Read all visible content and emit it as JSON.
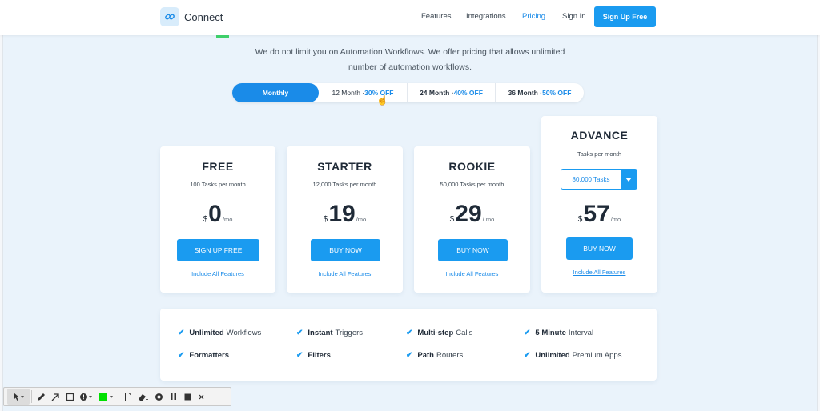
{
  "nav": {
    "brand": "Connect",
    "links": [
      "Features",
      "Integrations",
      "Pricing",
      "Sign In"
    ],
    "active_link": "Pricing",
    "signup_label": "Sign Up Free"
  },
  "intro": {
    "line1": "We do not limit you on Automation Workflows. We offer pricing that allows unlimited",
    "line2": "number of automation workflows."
  },
  "periods": [
    {
      "label": "Monthly",
      "off": ""
    },
    {
      "label": "12 Month · ",
      "off": "30% OFF"
    },
    {
      "label": "24 Month · ",
      "off": "40% OFF"
    },
    {
      "label": "36 Month · ",
      "off": "50% OFF"
    }
  ],
  "plans": [
    {
      "name": "FREE",
      "tasks": "100 Tasks per month",
      "currency": "$",
      "price": "0",
      "per": "/mo",
      "cta": "SIGN UP FREE",
      "link": "Include All Features"
    },
    {
      "name": "STARTER",
      "tasks": "12,000 Tasks per month",
      "currency": "$",
      "price": "19",
      "per": "/mo",
      "cta": "BUY NOW",
      "link": "Include All Features"
    },
    {
      "name": "ROOKIE",
      "tasks": "50,000 Tasks per month",
      "currency": "$",
      "price": "29",
      "per": "/ mo",
      "cta": "BUY NOW",
      "link": "Include All Features"
    },
    {
      "name": "ADVANCE",
      "tasks": "Tasks per month",
      "select_value": "80,000 Tasks",
      "currency": "$",
      "price": "57",
      "per": "/mo",
      "cta": "BUY NOW",
      "link": "Include All Features"
    }
  ],
  "features": [
    {
      "bold": "Unlimited",
      "rest": "Workflows"
    },
    {
      "bold": "Instant",
      "rest": "Triggers"
    },
    {
      "bold": "Multi-step",
      "rest": "Calls"
    },
    {
      "bold": "5 Minute",
      "rest": "Interval"
    },
    {
      "bold": "Formatters",
      "rest": ""
    },
    {
      "bold": "Filters",
      "rest": ""
    },
    {
      "bold": "Path",
      "rest": "Routers"
    },
    {
      "bold": "Unlimited",
      "rest": "Premium Apps"
    }
  ],
  "colors": {
    "accent": "#1a9bf0",
    "bg": "#eaf3fb",
    "annotation_green": "#00e000"
  }
}
